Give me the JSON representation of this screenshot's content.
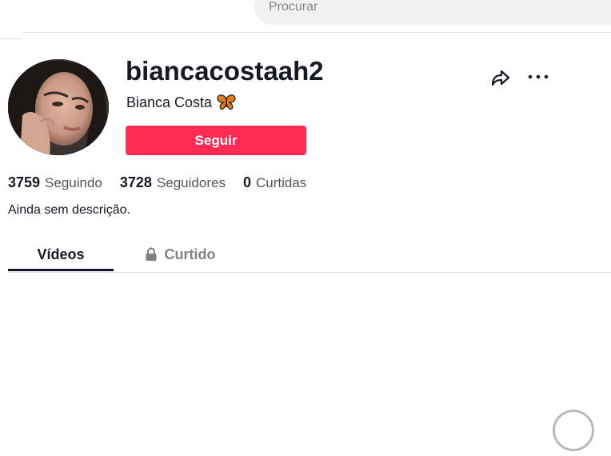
{
  "search": {
    "placeholder": "Procurar"
  },
  "profile": {
    "username": "biancacostaah2",
    "display_name": "Bianca Costa",
    "emoji": "butterfly-icon",
    "follow_label": "Seguir",
    "bio": "Ainda sem descrição."
  },
  "stats": [
    {
      "value": "3759",
      "label": "Seguindo"
    },
    {
      "value": "3728",
      "label": "Seguidores"
    },
    {
      "value": "0",
      "label": "Curtidas"
    }
  ],
  "tabs": [
    {
      "label": "Vídeos",
      "active": true
    },
    {
      "label": "Curtido",
      "icon": "lock-icon",
      "active": false
    }
  ],
  "colors": {
    "accent": "#fe2c55",
    "text": "#161823"
  }
}
